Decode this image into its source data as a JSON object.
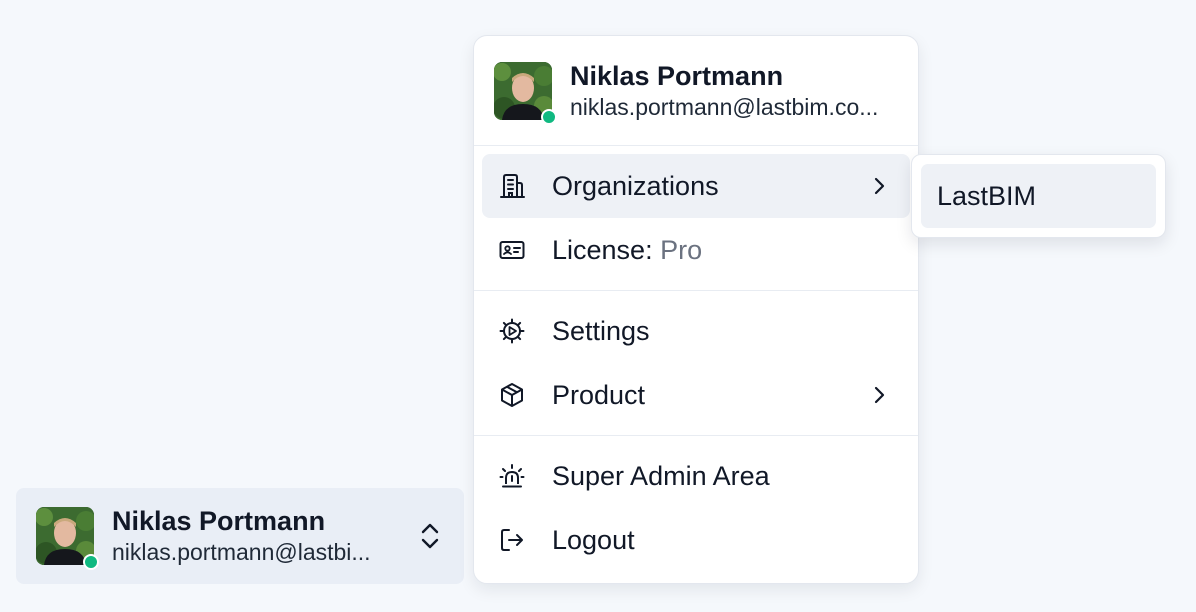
{
  "user": {
    "name": "Niklas Portmann",
    "email_menu": "niklas.portmann@lastbim.co...",
    "email_switcher": "niklas.portmann@lastbi...",
    "status": "online",
    "status_color": "#10b981"
  },
  "menu": {
    "organizations_label": "Organizations",
    "license_label": "License:",
    "license_value": "Pro",
    "settings_label": "Settings",
    "product_label": "Product",
    "super_admin_label": "Super Admin Area",
    "logout_label": "Logout"
  },
  "submenu": {
    "organizations": [
      "LastBIM"
    ]
  },
  "icons": {
    "organizations": "building-icon",
    "license": "id-card-icon",
    "settings": "gear-icon",
    "product": "box-icon",
    "super_admin": "siren-icon",
    "logout": "logout-icon",
    "expand": "chevron-right-icon",
    "switcher": "chevron-up-down-icon"
  },
  "colors": {
    "background": "#f5f8fc",
    "active_item": "#eef1f6",
    "switcher_bg": "#e9eef6",
    "muted_text": "#6b7280"
  }
}
